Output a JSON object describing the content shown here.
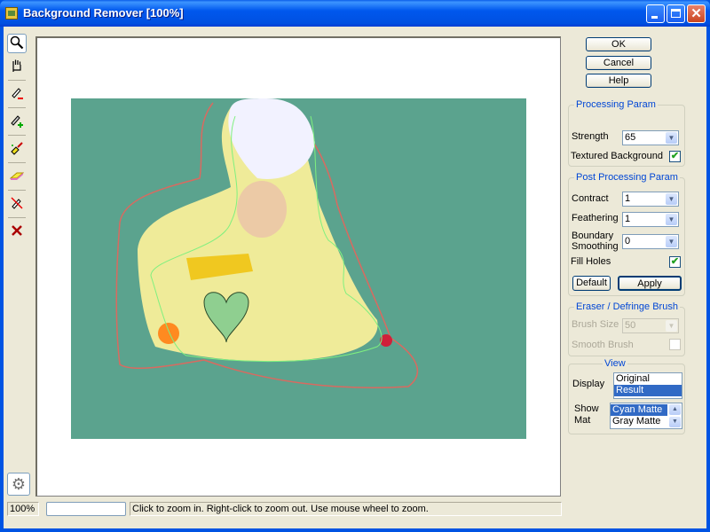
{
  "window": {
    "title": "Background Remover [100%]",
    "close_glyph": "✕"
  },
  "toolbar": {
    "tools": [
      {
        "name": "zoom-tool",
        "icon": "magnifier-icon",
        "glyph": "🔍",
        "active": true
      },
      {
        "name": "hand-tool",
        "icon": "hand-icon",
        "glyph": "✋"
      },
      {
        "name": "remove-marker-tool",
        "icon": "marker-minus-icon",
        "glyph": "✎"
      },
      {
        "name": "add-marker-tool",
        "icon": "marker-plus-icon",
        "glyph": "✎"
      },
      {
        "name": "magic-brush-tool",
        "icon": "magic-brush-icon",
        "glyph": "✦"
      },
      {
        "name": "eraser-tool",
        "icon": "eraser-icon",
        "glyph": "▰"
      },
      {
        "name": "clear-markers-tool",
        "icon": "clear-marker-icon",
        "glyph": "⊘"
      },
      {
        "name": "delete-tool",
        "icon": "x-delete-icon",
        "glyph": "✕"
      }
    ],
    "settings_glyph": "⚙"
  },
  "buttons": {
    "ok": "OK",
    "cancel": "Cancel",
    "help": "Help",
    "default": "Default",
    "apply": "Apply"
  },
  "processing": {
    "title": "Processing Param",
    "strength_label": "Strength",
    "strength_value": "65",
    "textured_label": "Textured Background",
    "textured_checked": true
  },
  "post_processing": {
    "title": "Post Processing Param",
    "contract_label": "Contract",
    "contract_value": "1",
    "feathering_label": "Feathering",
    "feathering_value": "1",
    "boundary_label_1": "Boundary",
    "boundary_label_2": "Smoothing",
    "boundary_value": "0",
    "fill_holes_label": "Fill Holes",
    "fill_holes_checked": true
  },
  "eraser": {
    "title": "Eraser / Defringe  Brush",
    "brush_size_label": "Brush Size",
    "brush_size_value": "50",
    "smooth_label": "Smooth Brush",
    "smooth_checked": false
  },
  "view": {
    "title": "View",
    "display_label": "Display",
    "display_options": [
      "Original",
      "Result"
    ],
    "display_selected": "Result",
    "showmat_label_1": "Show",
    "showmat_label_2": "Mat",
    "mat_options": [
      "Cyan Matte",
      "Gray Matte"
    ],
    "mat_selected": "Cyan Matte"
  },
  "status": {
    "zoom": "100%",
    "field": "",
    "message": "Click to zoom in. Right-click to zoom out. Use mouse wheel to zoom."
  },
  "colors": {
    "matte": "#5ba38e",
    "selection": "#316ac5",
    "group_title": "#0046d5"
  },
  "check_glyph": "✔",
  "arrow_down": "▼",
  "arrow_up": "▲"
}
